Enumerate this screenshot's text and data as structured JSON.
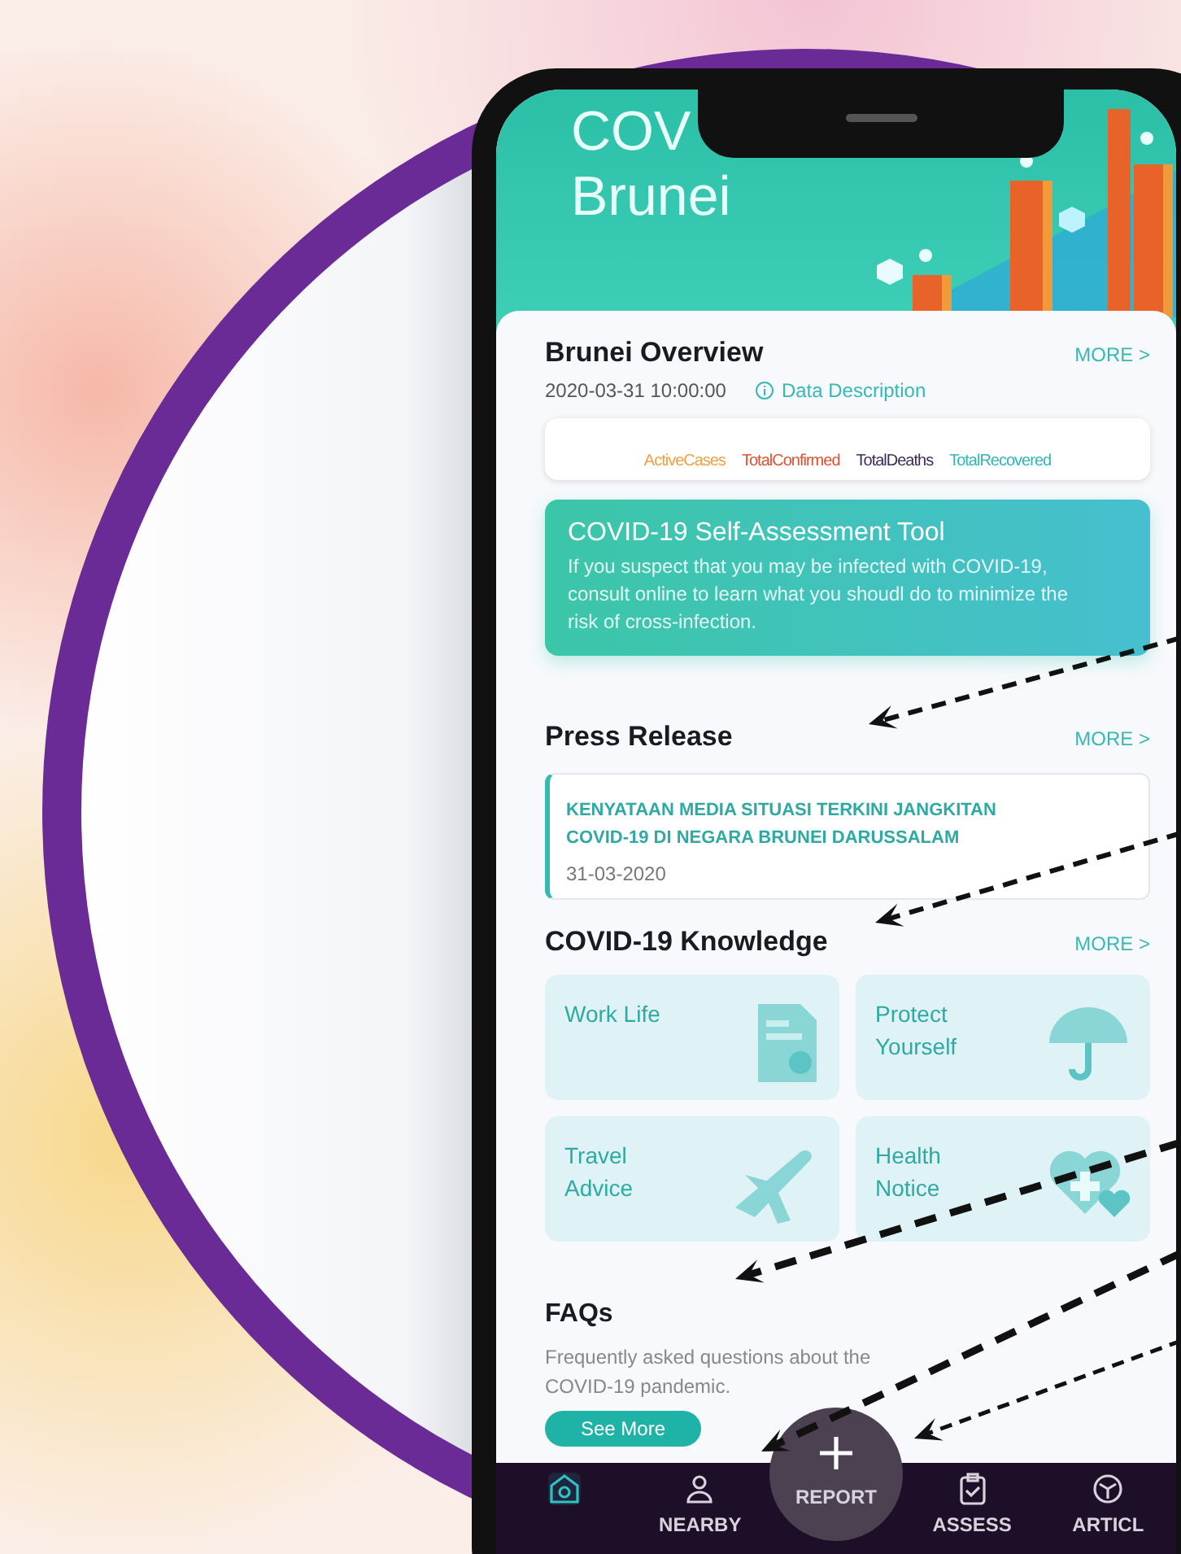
{
  "header": {
    "title_lines": [
      "COV",
      "Brunei"
    ]
  },
  "overview": {
    "title": "Brunei Overview",
    "more": "MORE >",
    "timestamp": "2020-03-31 10:00:00",
    "info_link": "Data Description",
    "legend": [
      {
        "label": "ActiveCases",
        "color": "#f0a040"
      },
      {
        "label": "TotalConfirmed",
        "color": "#e0502e"
      },
      {
        "label": "TotalDeaths",
        "color": "#3b2c58"
      },
      {
        "label": "TotalRecovered",
        "color": "#2fb6b4"
      }
    ]
  },
  "assessment_banner": {
    "title": "COVID-19 Self-Assessment Tool",
    "text": "If you suspect that you may be infected with COVID-19, consult online to learn what you shoudl do to minimize the risk of cross-infection."
  },
  "press_release": {
    "title": "Press Release",
    "more": "MORE >",
    "items": [
      {
        "headline": "KENYATAAN MEDIA SITUASI TERKINI JANGKITAN COVID-19 DI NEGARA BRUNEI DARUSSALAM",
        "date": "31-03-2020"
      }
    ]
  },
  "knowledge": {
    "title": "COVID-19 Knowledge",
    "more": "MORE >",
    "cards": [
      {
        "label": "Work Life",
        "kind": "document"
      },
      {
        "label": "Protect Yourself",
        "kind": "umbrella"
      },
      {
        "label": "Travel Advice",
        "kind": "plane"
      },
      {
        "label": "Health Notice",
        "kind": "heart"
      }
    ]
  },
  "faqs": {
    "title": "FAQs",
    "text": "Frequently asked questions about the COVID-19 pandemic.",
    "button": "See More"
  },
  "tab_bar": {
    "items": [
      {
        "kind": "home",
        "selected": true
      },
      {
        "kind": "people",
        "label": "NEARBY",
        "selected": false
      },
      {
        "kind": "report",
        "label": "REPORT",
        "selected": false
      },
      {
        "kind": "clipboard",
        "label": "ASSESS",
        "selected": false
      },
      {
        "kind": "cube",
        "label": "ARTICL",
        "selected": false
      }
    ]
  }
}
